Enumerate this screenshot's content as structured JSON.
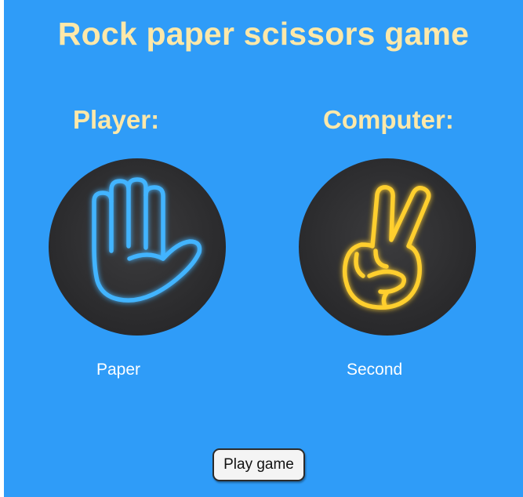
{
  "game": {
    "title": "Rock paper scissors game",
    "player": {
      "heading": "Player:",
      "choice": "Paper",
      "icon": "paper-hand-icon",
      "neon_color": "#43b4ff"
    },
    "computer": {
      "heading": "Computer:",
      "choice": "Second",
      "icon": "scissors-hand-icon",
      "neon_color": "#ffcf2e"
    },
    "play_button_label": "Play game"
  },
  "colors": {
    "background": "#2f9cf8",
    "heading_text": "#fde8a9",
    "label_text": "#ffffff"
  }
}
